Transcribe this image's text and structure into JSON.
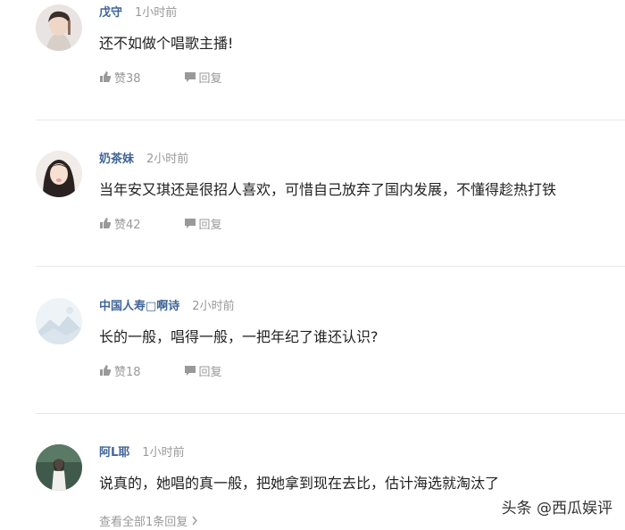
{
  "comments": [
    {
      "username": "戊守",
      "time": "1小时前",
      "text": "还不如做个唱歌主播!",
      "like_label": "赞38",
      "reply_label": "回复"
    },
    {
      "username": "奶茶妹",
      "time": "2小时前",
      "text": "当年安又琪还是很招人喜欢，可惜自己放弃了国内发展，不懂得趁热打铁",
      "like_label": "赞42",
      "reply_label": "回复"
    },
    {
      "username": "中国人寿□啊诗",
      "time": "2小时前",
      "text": "长的一般，唱得一般，一把年纪了谁还认识?",
      "like_label": "赞18",
      "reply_label": "回复"
    },
    {
      "username": "阿L耶",
      "time": "1小时前",
      "text": "说真的，她唱的真一般，把她拿到现在去比，估计海选就淘汰了",
      "view_all_label": "查看全部1条回复"
    }
  ],
  "watermark": "头条 @西瓜娱评",
  "colors": {
    "username": "#406599",
    "meta_gray": "#999999",
    "text": "#222222",
    "divider": "#e8e8e8"
  },
  "icons": {
    "like": "thumbs-up-icon",
    "reply": "speech-bubble-icon",
    "chevron": "chevron-right-icon"
  }
}
